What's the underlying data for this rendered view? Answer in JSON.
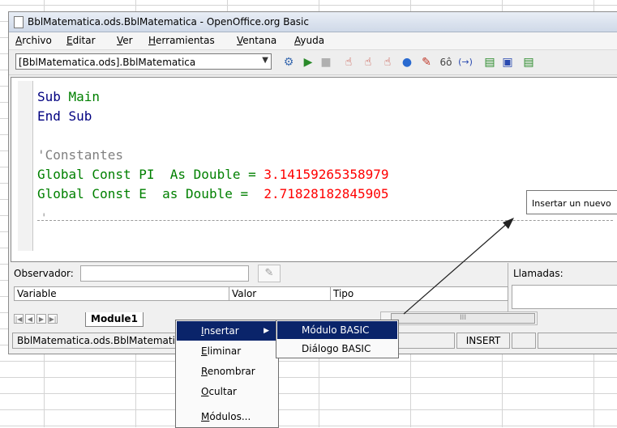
{
  "window": {
    "title": "BblMatematica.ods.BblMatematica - OpenOffice.org Basic"
  },
  "menu": [
    "Archivo",
    "Editar",
    "Ver",
    "Herramientas",
    "Ventana",
    "Ayuda"
  ],
  "toolbar": {
    "library_combo": "[BblMatematica.ods].BblMatematica",
    "icons": [
      "compile-icon",
      "run-icon",
      "stop-icon",
      "step-into-icon",
      "step-over-icon",
      "step-out-icon",
      "breakpoint-icon",
      "manage-breakpoints-icon",
      "add-watch-icon",
      "find-parentheses-icon",
      "insert-basic-source-icon",
      "save-basic-icon",
      "import-dialog-icon"
    ]
  },
  "editor": {
    "lines": [
      {
        "a": "Sub ",
        "b": "Main"
      },
      {
        "a": "End Sub"
      },
      {
        "a": ""
      },
      {
        "comment": "'Constantes"
      },
      {
        "a": "Global Const ",
        "b": "PI",
        "c": "  As Double = ",
        "d": "3.14159265358979"
      },
      {
        "a": "Global Const ",
        "b": "E",
        "c": "  as Double =  ",
        "d": "2.71828182845905"
      }
    ],
    "separator_tick": "'"
  },
  "tooltip": "Insertar un nuevo",
  "watch": {
    "label": "Observador:",
    "columns": [
      "Variable",
      "Valor",
      "Tipo"
    ]
  },
  "calls": {
    "label": "Llamadas:"
  },
  "tabs": {
    "module_tab": "Module1"
  },
  "scrollbar": {
    "thumb_mark": "III"
  },
  "status": {
    "location": "BblMatematica.ods.BblMatematica",
    "mode": "INSERT"
  },
  "context_menu": {
    "items": [
      "Insertar",
      "Eliminar",
      "Renombrar",
      "Ocultar",
      "Módulos..."
    ],
    "selected": "Insertar"
  },
  "submenu": {
    "items": [
      "Módulo BASIC",
      "Diálogo BASIC"
    ],
    "selected": "Módulo BASIC"
  },
  "colors": {
    "keyword": "#000080",
    "identifier": "#008000",
    "comment": "#808080",
    "number": "#ff0000",
    "menu_highlight": "#0a246a"
  }
}
